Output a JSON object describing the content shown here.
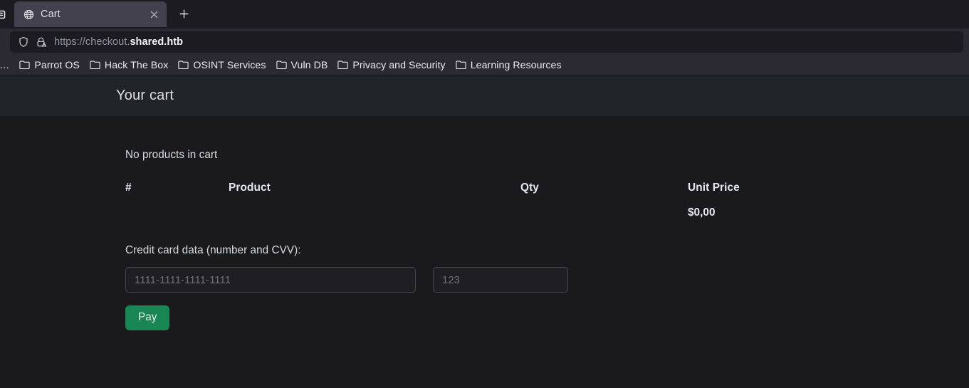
{
  "browser": {
    "sidebar_toggle_icon": "list-all-tabs-icon",
    "tabs": [
      {
        "favicon": "globe-icon",
        "title": "Cart",
        "close_icon": "close-icon"
      }
    ],
    "new_tab_label": "+",
    "new_tab_icon": "plus-icon",
    "urlbar": {
      "shield_icon": "shield-icon",
      "lock_warning_icon": "lock-warning-icon",
      "url_scheme": "https://checkout.",
      "url_host": "shared.htb",
      "url_full": "https://checkout.shared.htb"
    },
    "bookmarks": [
      {
        "icon": "folder-icon",
        "label": "s…",
        "truncated": true
      },
      {
        "icon": "folder-icon",
        "label": "Parrot OS"
      },
      {
        "icon": "folder-icon",
        "label": "Hack The Box"
      },
      {
        "icon": "folder-icon",
        "label": "OSINT Services"
      },
      {
        "icon": "folder-icon",
        "label": "Vuln DB"
      },
      {
        "icon": "folder-icon",
        "label": "Privacy and Security"
      },
      {
        "icon": "folder-icon",
        "label": "Learning Resources"
      }
    ]
  },
  "page": {
    "navbar": {
      "brand": "Your cart"
    },
    "empty_message": "No products in cart",
    "table": {
      "headers": [
        "#",
        "Product",
        "Qty",
        "Unit Price"
      ],
      "rows": [],
      "total_row": {
        "num": "",
        "product": "",
        "qty": "",
        "unit_price": "$0,00"
      }
    },
    "form": {
      "label": "Credit card data (number and CVV):",
      "card_number": {
        "value": "",
        "placeholder": "1111-1111-1111-1111"
      },
      "cvv": {
        "value": "",
        "placeholder": "123"
      },
      "submit_label": "Pay"
    },
    "colors": {
      "navbar_bg": "#212529",
      "body_bg": "#1a1a1d",
      "pay_button": "#198754",
      "text": "#dee2e6"
    }
  }
}
